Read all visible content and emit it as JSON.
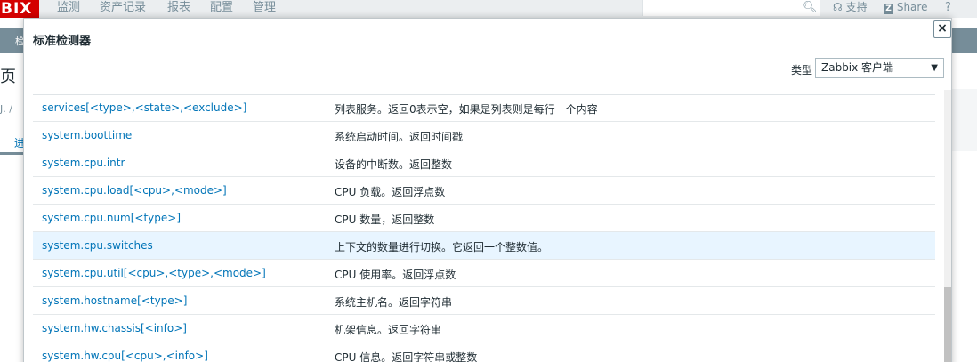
{
  "nav": {
    "logo": "BIX",
    "items": [
      "监测",
      "资产记录",
      "报表",
      "配置",
      "管理"
    ],
    "support": "支持",
    "share": "Share",
    "help": "?"
  },
  "background": {
    "frag1": "检",
    "frag2": "页",
    "frag3": "J. /",
    "frag4": "进"
  },
  "dialog": {
    "title": "标准检测器",
    "close_label": "×",
    "type_label": "类型",
    "type_value": "Zabbix 客户端",
    "items": [
      {
        "key": "services[<type>,<state>,<exclude>]",
        "desc": "列表服务。返回0表示空，如果是列表则是每行一个内容"
      },
      {
        "key": "system.boottime",
        "desc": "系统启动时间。返回时间戳"
      },
      {
        "key": "system.cpu.intr",
        "desc": "设备的中断数。返回整数"
      },
      {
        "key": "system.cpu.load[<cpu>,<mode>]",
        "desc": "CPU 负载。返回浮点数"
      },
      {
        "key": "system.cpu.num[<type>]",
        "desc": "CPU 数量，返回整数"
      },
      {
        "key": "system.cpu.switches",
        "desc": "上下文的数量进行切换。它返回一个整数值。"
      },
      {
        "key": "system.cpu.util[<cpu>,<type>,<mode>]",
        "desc": "CPU 使用率。返回浮点数"
      },
      {
        "key": "system.hostname[<type>]",
        "desc": "系统主机名。返回字符串"
      },
      {
        "key": "system.hw.chassis[<info>]",
        "desc": "机架信息。返回字符串"
      },
      {
        "key": "system.hw.cpu[<cpu>,<info>]",
        "desc": "CPU 信息。返回字符串或整数"
      }
    ]
  }
}
